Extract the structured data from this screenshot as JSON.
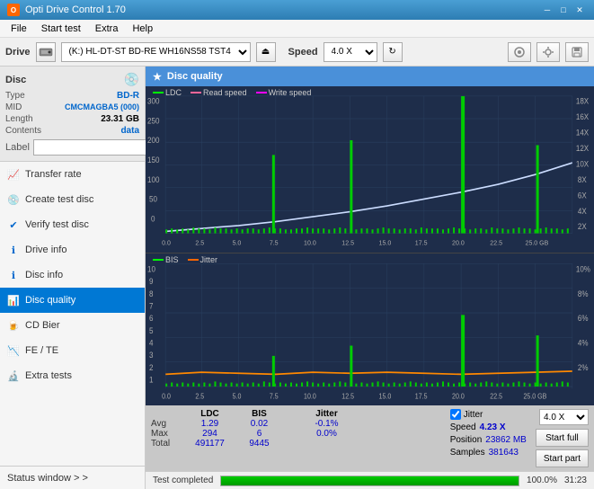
{
  "app": {
    "title": "Opti Drive Control 1.70",
    "icon": "O"
  },
  "titlebar": {
    "minimize": "─",
    "maximize": "□",
    "close": "✕"
  },
  "menu": {
    "items": [
      "File",
      "Start test",
      "Extra",
      "Help"
    ]
  },
  "drive_bar": {
    "label": "Drive",
    "drive_value": "(K:) HL-DT-ST BD-RE  WH16NS58 TST4",
    "speed_label": "Speed",
    "speed_value": "4.0 X",
    "eject_icon": "⏏"
  },
  "disc": {
    "title": "Disc",
    "type_label": "Type",
    "type_value": "BD-R",
    "mid_label": "MID",
    "mid_value": "CMCMAGBA5 (000)",
    "length_label": "Length",
    "length_value": "23.31 GB",
    "contents_label": "Contents",
    "contents_value": "data",
    "label_label": "Label"
  },
  "nav": {
    "items": [
      {
        "id": "transfer-rate",
        "label": "Transfer rate",
        "icon": "📈"
      },
      {
        "id": "create-test-disc",
        "label": "Create test disc",
        "icon": "💿"
      },
      {
        "id": "verify-test-disc",
        "label": "Verify test disc",
        "icon": "✔"
      },
      {
        "id": "drive-info",
        "label": "Drive info",
        "icon": "ℹ"
      },
      {
        "id": "disc-info",
        "label": "Disc info",
        "icon": "ℹ"
      },
      {
        "id": "disc-quality",
        "label": "Disc quality",
        "icon": "📊",
        "active": true
      },
      {
        "id": "cd-bier",
        "label": "CD Bier",
        "icon": "🍺"
      },
      {
        "id": "fe-te",
        "label": "FE / TE",
        "icon": "📉"
      },
      {
        "id": "extra-tests",
        "label": "Extra tests",
        "icon": "🔬"
      }
    ]
  },
  "status_window": {
    "label": "Status window > >"
  },
  "content": {
    "header": "Disc quality",
    "header_icon": "★"
  },
  "legend": {
    "ldc": "LDC",
    "read_speed": "Read speed",
    "write_speed": "Write speed",
    "bis": "BIS",
    "jitter": "Jitter"
  },
  "stats": {
    "columns": [
      "LDC",
      "BIS",
      "",
      "Jitter",
      "Speed",
      ""
    ],
    "avg_label": "Avg",
    "avg_ldc": "1.29",
    "avg_bis": "0.02",
    "avg_jitter": "-0.1%",
    "max_label": "Max",
    "max_ldc": "294",
    "max_bis": "6",
    "max_jitter": "0.0%",
    "total_label": "Total",
    "total_ldc": "491177",
    "total_bis": "9445",
    "speed_label": "Speed",
    "speed_value": "4.23 X",
    "speed_select": "4.0 X",
    "position_label": "Position",
    "position_value": "23862 MB",
    "samples_label": "Samples",
    "samples_value": "381643",
    "jitter_checked": true,
    "start_full": "Start full",
    "start_part": "Start part"
  },
  "bottom": {
    "status_text": "Test completed",
    "progress_pct": 100,
    "progress_text": "100.0%",
    "time_text": "31:23"
  },
  "chart1": {
    "y_max": 300,
    "y_labels": [
      "300",
      "250",
      "200",
      "150",
      "100",
      "50",
      "0"
    ],
    "y_right_labels": [
      "18X",
      "16X",
      "14X",
      "12X",
      "10X",
      "8X",
      "6X",
      "4X",
      "2X"
    ],
    "x_labels": [
      "0.0",
      "2.5",
      "5.0",
      "7.5",
      "10.0",
      "12.5",
      "15.0",
      "17.5",
      "20.0",
      "22.5",
      "25.0 GB"
    ]
  },
  "chart2": {
    "y_max": 10,
    "y_labels": [
      "10",
      "9",
      "8",
      "7",
      "6",
      "5",
      "4",
      "3",
      "2",
      "1"
    ],
    "y_right_labels": [
      "10%",
      "8%",
      "6%",
      "4%",
      "2%"
    ],
    "x_labels": [
      "0.0",
      "2.5",
      "5.0",
      "7.5",
      "10.0",
      "12.5",
      "15.0",
      "17.5",
      "20.0",
      "22.5",
      "25.0 GB"
    ]
  }
}
